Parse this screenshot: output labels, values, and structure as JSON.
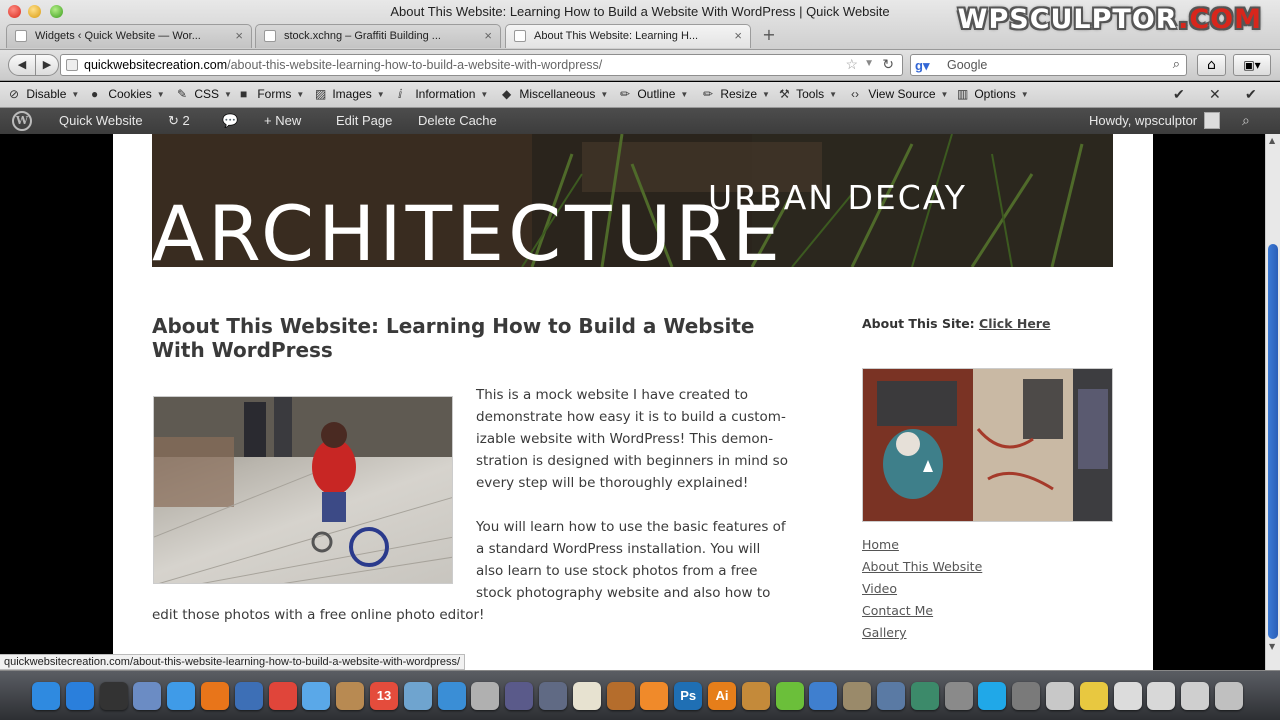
{
  "window": {
    "title": "About This Website: Learning How to Build a Website With WordPress | Quick Website",
    "brand_main": "WPSCULPTOR",
    "brand_suffix": ".COM"
  },
  "tabs": [
    {
      "label": "Widgets ‹ Quick Website — Wor...",
      "active": false
    },
    {
      "label": "stock.xchng – Graffiti Building ...",
      "active": false
    },
    {
      "label": "About This Website: Learning H...",
      "active": true
    }
  ],
  "navbar": {
    "url_domain": "quickwebsitecreation.com",
    "url_path": "/about-this-website-learning-how-to-build-a-website-with-wordpress/",
    "search_placeholder": "Google"
  },
  "devbar": {
    "items": [
      {
        "label": "Disable",
        "icon": "disable-icon"
      },
      {
        "label": "Cookies",
        "icon": "cookies-icon"
      },
      {
        "label": "CSS",
        "icon": "css-icon"
      },
      {
        "label": "Forms",
        "icon": "forms-icon"
      },
      {
        "label": "Images",
        "icon": "images-icon"
      },
      {
        "label": "Information",
        "icon": "information-icon"
      },
      {
        "label": "Miscellaneous",
        "icon": "miscellaneous-icon"
      },
      {
        "label": "Outline",
        "icon": "outline-icon"
      },
      {
        "label": "Resize",
        "icon": "resize-icon"
      },
      {
        "label": "Tools",
        "icon": "tools-icon"
      },
      {
        "label": "View Source",
        "icon": "view-source-icon"
      },
      {
        "label": "Options",
        "icon": "options-icon"
      }
    ]
  },
  "adminbar": {
    "site_name": "Quick Website",
    "updates_count": "2",
    "new_label": "New",
    "edit_label": "Edit Page",
    "cache_label": "Delete Cache",
    "howdy": "Howdy, wpsculptor"
  },
  "header": {
    "subtitle": "URBAN DECAY",
    "title": "ARCHITECTURE"
  },
  "post": {
    "title": "About This Website: Learning How to Build a Website With WordPress",
    "paragraph1": "This is a mock website I have created to demonstrate how easy it is to build a custom-izable website with WordPress!  This demon-stration is designed with beginners in mind so every step will be thoroughly explained!",
    "paragraph2": "You will learn how to use the basic features of a standard WordPress installation.  You will also learn to use stock photos from a free stock photography website and also how to",
    "paragraph2_end": "edit those photos with a free online photo editor!"
  },
  "sidebar": {
    "about_label": "About This Site:",
    "about_link": "Click Here",
    "nav": [
      "Home",
      "About This Website",
      "Video",
      "Contact Me",
      "Gallery"
    ]
  },
  "statusbar": {
    "text": "quickwebsitecreation.com/about-this-website-learning-how-to-build-a-website-with-wordpress/"
  },
  "dock": {
    "apps": [
      {
        "name": "finder",
        "color": "#2f8ae0"
      },
      {
        "name": "app-store",
        "color": "#2a7fdc"
      },
      {
        "name": "dashboard",
        "color": "#333333"
      },
      {
        "name": "preview",
        "color": "#6b8cc4"
      },
      {
        "name": "safari",
        "color": "#3f9be8"
      },
      {
        "name": "firefox",
        "color": "#e8751a"
      },
      {
        "name": "thunderbird",
        "color": "#3d6fb6"
      },
      {
        "name": "chrome",
        "color": "#e0453a"
      },
      {
        "name": "ichat",
        "color": "#5aa8e8"
      },
      {
        "name": "address-book",
        "color": "#b88a52"
      },
      {
        "name": "ical",
        "color": "#e44c3c"
      },
      {
        "name": "iphoto",
        "color": "#6fa4cf"
      },
      {
        "name": "itunes",
        "color": "#3a8ed6"
      },
      {
        "name": "ipod",
        "color": "#b0b0b0"
      },
      {
        "name": "imovie",
        "color": "#5a5a8a"
      },
      {
        "name": "dvd-player",
        "color": "#606a84"
      },
      {
        "name": "textedit",
        "color": "#e7e2d0"
      },
      {
        "name": "photo-editor",
        "color": "#b56d2c"
      },
      {
        "name": "audacity",
        "color": "#f08a2a"
      },
      {
        "name": "photoshop",
        "color": "#1f6fb4"
      },
      {
        "name": "illustrator",
        "color": "#e67e1a"
      },
      {
        "name": "guitar",
        "color": "#c48a3a"
      },
      {
        "name": "spotify",
        "color": "#6bbf3a"
      },
      {
        "name": "wordpress",
        "color": "#3f7fcf"
      },
      {
        "name": "gimp",
        "color": "#9a8a6a"
      },
      {
        "name": "app-grid",
        "color": "#5a7aa4"
      },
      {
        "name": "time-machine",
        "color": "#3c8a6a"
      },
      {
        "name": "system-preferences",
        "color": "#8a8a8a"
      },
      {
        "name": "skype",
        "color": "#20a8e8"
      },
      {
        "name": "media-app",
        "color": "#7a7a7a"
      },
      {
        "name": "cat-app",
        "color": "#c8c8c8"
      },
      {
        "name": "wifi",
        "color": "#e8c840"
      },
      {
        "name": "documents",
        "color": "#dcdcdc"
      },
      {
        "name": "downloads",
        "color": "#d8d8d8"
      },
      {
        "name": "folder",
        "color": "#cfcfcf"
      },
      {
        "name": "trash",
        "color": "#c0c0c0"
      }
    ],
    "labels": {
      "photoshop": "Ps",
      "illustrator": "Ai",
      "ical": "13"
    }
  }
}
